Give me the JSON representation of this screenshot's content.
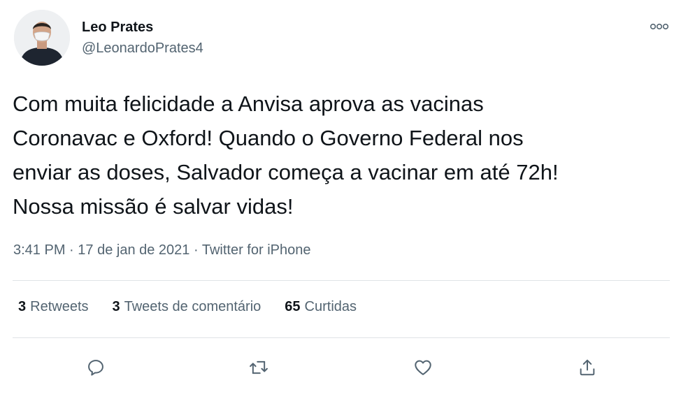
{
  "author": {
    "name": "Leo Prates",
    "handle": "@LeonardoPrates4"
  },
  "tweet": {
    "lines": [
      "Com muita felicidade a Anvisa aprova as vacinas",
      "Coronavac e Oxford! Quando o Governo Federal nos",
      "enviar as doses, Salvador começa a vacinar em até 72h!",
      "Nossa missão é salvar vidas!"
    ]
  },
  "meta": {
    "time": "3:41 PM",
    "separator": "·",
    "date": "17 de jan de 2021",
    "source": "Twitter for iPhone"
  },
  "stats": {
    "retweets_count": "3",
    "retweets_label": "Retweets",
    "replies_count": "3",
    "replies_label": "Tweets de comentário",
    "likes_count": "65",
    "likes_label": "Curtidas"
  },
  "icons": {
    "more": "more-horizontal-icon",
    "reply": "reply-icon",
    "retweet": "retweet-icon",
    "like": "heart-icon",
    "share": "share-icon"
  },
  "colors": {
    "text": "#0f1419",
    "secondary": "#536471",
    "divider": "#dfe3e6"
  }
}
